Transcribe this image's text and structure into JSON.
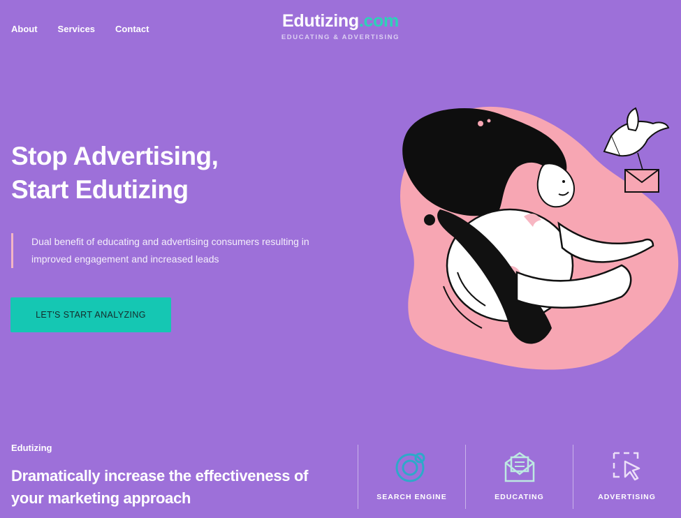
{
  "nav": {
    "items": [
      {
        "label": "About"
      },
      {
        "label": "Services"
      },
      {
        "label": "Contact"
      }
    ]
  },
  "logo": {
    "name": "Edutizing",
    "tld": ".com",
    "tagline": "EDUCATING & ADVERTISING"
  },
  "hero": {
    "title_line1": "Stop Advertising,",
    "title_line2": "Start Edutizing",
    "description": "Dual benefit of educating and advertising consumers resulting in improved engagement and increased leads",
    "cta_label": "LET'S START ANALYZING"
  },
  "section": {
    "eyebrow": "Edutizing",
    "heading": "Dramatically increase the effectiveness of your marketing approach"
  },
  "features": [
    {
      "label": "SEARCH ENGINE",
      "icon": "search-engine-icon"
    },
    {
      "label": "EDUCATING",
      "icon": "envelope-icon"
    },
    {
      "label": "ADVERTISING",
      "icon": "cursor-select-icon"
    }
  ],
  "colors": {
    "background": "#9d70d9",
    "accent": "#15c7b3",
    "blob": "#f7a6b3",
    "logo_dot": "#2ed1b8"
  }
}
